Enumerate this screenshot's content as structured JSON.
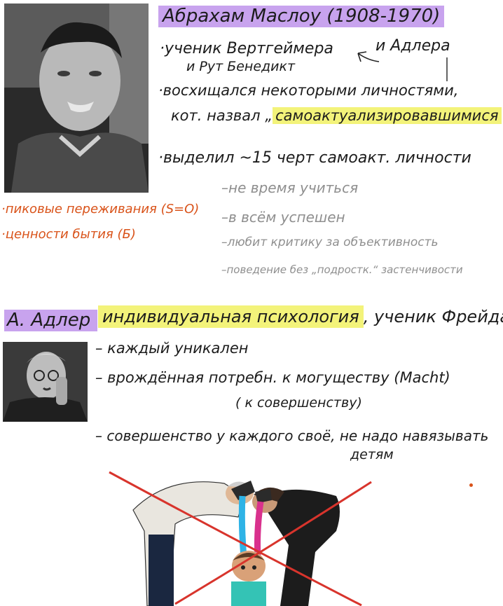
{
  "maslow": {
    "heading": "Абрахам Маслоу (1908-1970)",
    "line1": "·ученик Вертгеймера",
    "line1b": "и Адлера",
    "line2": "и Рут Бенедикт",
    "line3": "·восхищался некоторыми личностями,",
    "line4a": "кот. назвал „",
    "line4b": "самоактуализировавшимися",
    "line4c": "“",
    "line5": "·выделил ~15 черт самоакт. личности",
    "traits": [
      "–не время учиться",
      "–в всём успешен",
      "–любит критику за объективность",
      "–поведение без „подростк.“ застенчивости"
    ],
    "side_notes": [
      "·пиковые переживания (S=O)",
      "·ценности бытия (Б)"
    ]
  },
  "adler": {
    "name": "А. Адлер",
    "school": "индивидуальная психология",
    "school_tail": ", ученик Фрейда",
    "points": [
      "– каждый уникален",
      "– врождённая потребн. к могуществу (Macht)",
      "( к совершенству)",
      "– совершенство у каждого своё, не надо навязывать",
      "детям"
    ]
  },
  "colors": {
    "highlight_purple": "#c8a3ee",
    "highlight_yellow": "#f3f37a",
    "note_orange": "#d9531a",
    "cross_red": "#d8342c"
  }
}
